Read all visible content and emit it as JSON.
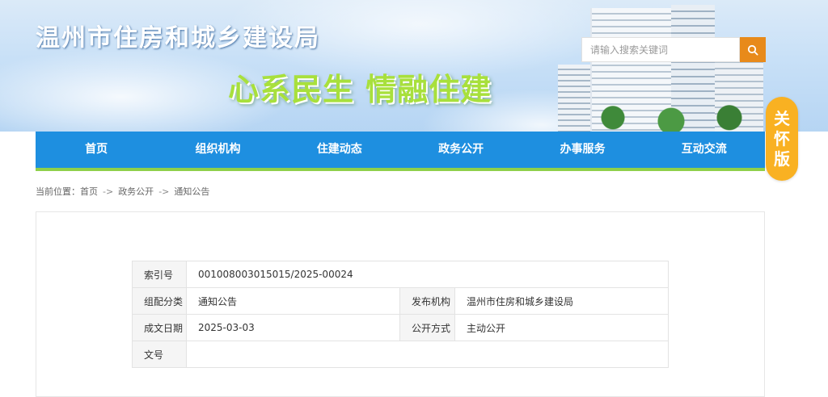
{
  "header": {
    "site_title": "温州市住房和城乡建设局",
    "slogan": "心系民生 情融住建",
    "search_placeholder": "请输入搜索关键词",
    "search_icon": "search-icon"
  },
  "care_version": {
    "chars": [
      "关",
      "怀",
      "版"
    ]
  },
  "nav": {
    "items": [
      "首页",
      "组织机构",
      "住建动态",
      "政务公开",
      "办事服务",
      "互动交流"
    ]
  },
  "breadcrumb": {
    "prefix": "当前位置：",
    "items": [
      "首页",
      "政务公开",
      "通知公告"
    ],
    "separator": "->"
  },
  "meta": {
    "index_label": "索引号",
    "index_value": "001008003015015/2025-00024",
    "category_label": "组配分类",
    "category_value": "通知公告",
    "publisher_label": "发布机构",
    "publisher_value": "温州市住房和城乡建设局",
    "date_label": "成文日期",
    "date_value": "2025-03-03",
    "disclosure_label": "公开方式",
    "disclosure_value": "主动公开",
    "docno_label": "文号",
    "docno_value": ""
  },
  "colors": {
    "nav_bg": "#1e8fe0",
    "nav_underline": "#8fd04a",
    "search_button": "#e88a1a",
    "care_badge": "#f9b122",
    "slogan": "#a8e03c"
  }
}
